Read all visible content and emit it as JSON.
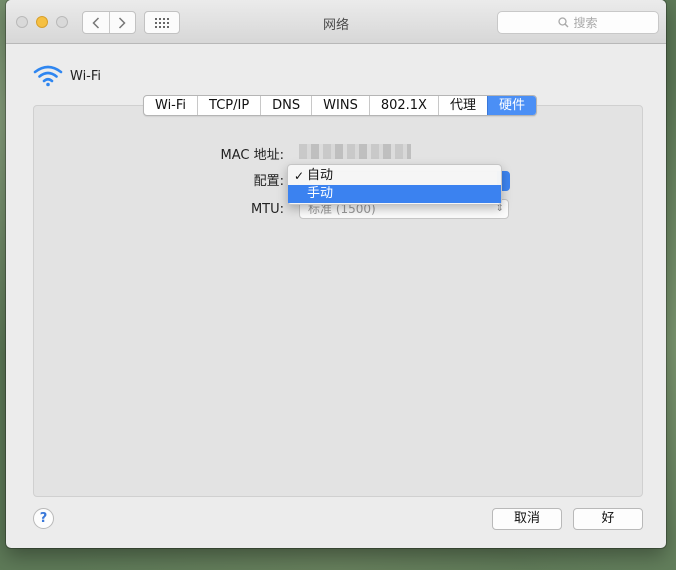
{
  "window": {
    "title": "网络"
  },
  "toolbar": {
    "search_placeholder": "搜索"
  },
  "header": {
    "interface_name": "Wi-Fi"
  },
  "tabs": [
    {
      "label": "Wi-Fi"
    },
    {
      "label": "TCP/IP"
    },
    {
      "label": "DNS"
    },
    {
      "label": "WINS"
    },
    {
      "label": "802.1X"
    },
    {
      "label": "代理"
    },
    {
      "label": "硬件",
      "active": true
    }
  ],
  "form": {
    "mac_label": "MAC 地址:",
    "config_label": "配置:",
    "mtu_label": "MTU:",
    "mtu_value": "标准 (1500)"
  },
  "config_menu": {
    "items": [
      {
        "label": "自动",
        "checked": true
      },
      {
        "label": "手动",
        "highlighted": true
      }
    ]
  },
  "footer": {
    "help_label": "?",
    "cancel_label": "取消",
    "ok_label": "好"
  },
  "colors": {
    "accent": "#4b8ff5",
    "traffic_minimize": "#f6c042"
  }
}
